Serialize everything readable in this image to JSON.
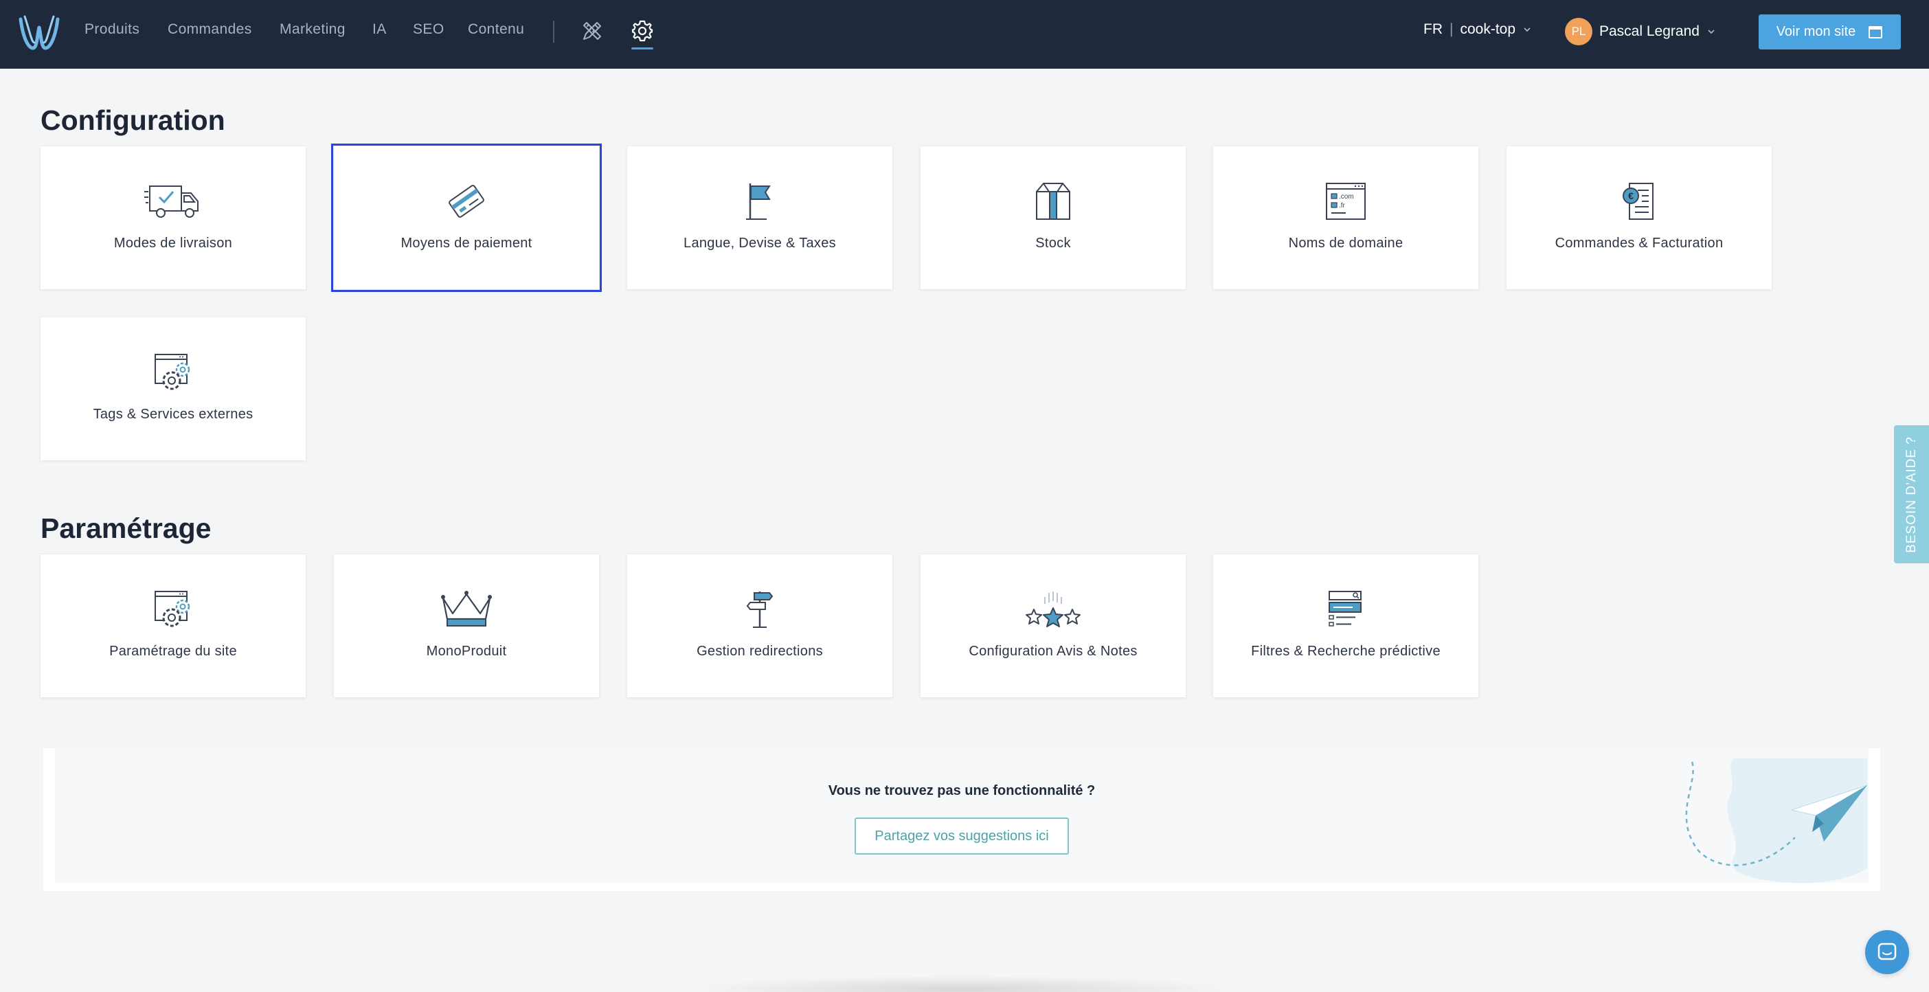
{
  "colors": {
    "topbar_bg": "#1e2a3c",
    "accent": "#4ba3e0",
    "selected_outline": "#2d44d8",
    "icon_blue": "#4f9cc4",
    "avatar": "#f2a15a"
  },
  "header": {
    "logo_icon": "w-logo-icon",
    "nav": [
      {
        "label": "Produits"
      },
      {
        "label": "Commandes"
      },
      {
        "label": "Marketing"
      },
      {
        "label": "IA"
      },
      {
        "label": "SEO"
      },
      {
        "label": "Contenu"
      }
    ],
    "tools_icon": "design-tools-icon",
    "settings_icon": "gear-icon",
    "active_nav": "settings",
    "language": "FR",
    "language_separator": "|",
    "site": "cook-top",
    "user": {
      "initials": "PL",
      "name": "Pascal Legrand"
    },
    "site_button": {
      "label": "Voir mon site",
      "icon": "browser-icon"
    }
  },
  "configuration": {
    "title": "Configuration",
    "cards": [
      {
        "label": "Modes de livraison",
        "icon": "delivery-truck-icon"
      },
      {
        "label": "Moyens de paiement",
        "icon": "credit-card-icon",
        "selected": true
      },
      {
        "label": "Langue, Devise & Taxes",
        "icon": "flag-icon"
      },
      {
        "label": "Stock",
        "icon": "box-icon"
      },
      {
        "label": "Noms de domaine",
        "icon": "domain-window-icon",
        "icon_text": [
          ".com",
          ".fr"
        ]
      },
      {
        "label": "Commandes & Facturation",
        "icon": "invoice-icon",
        "icon_text": "€"
      },
      {
        "label": "Tags & Services externes",
        "icon": "window-gears-icon"
      }
    ]
  },
  "parametrage": {
    "title": "Paramétrage",
    "cards": [
      {
        "label": "Paramétrage du site",
        "icon": "window-gears-icon"
      },
      {
        "label": "MonoProduit",
        "icon": "crown-icon"
      },
      {
        "label": "Gestion redirections",
        "icon": "signpost-icon"
      },
      {
        "label": "Configuration Avis & Notes",
        "icon": "stars-icon"
      },
      {
        "label": "Filtres & Recherche prédictive",
        "icon": "search-filter-icon"
      }
    ]
  },
  "suggestion": {
    "text": "Vous ne trouvez pas une fonctionnalité ?",
    "button": "Partagez vos suggestions ici",
    "illustration": "paper-plane-icon"
  },
  "help_tab": "BESOIN D'AIDE ?",
  "chat_icon": "chat-bubble-icon"
}
